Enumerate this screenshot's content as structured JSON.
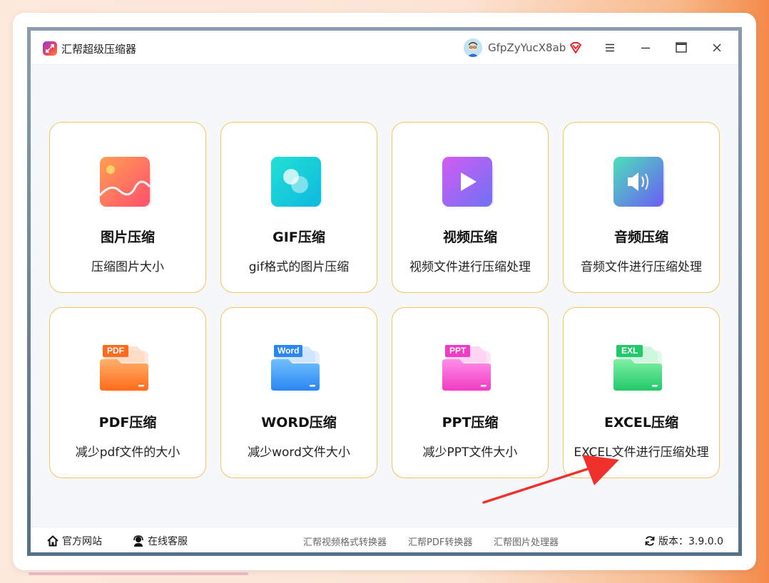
{
  "app": {
    "title": "汇帮超级压缩器",
    "username": "GfpZyYucX8ab"
  },
  "cards": [
    {
      "title": "图片压缩",
      "desc": "压缩图片大小"
    },
    {
      "title": "GIF压缩",
      "desc": "gif格式的图片压缩"
    },
    {
      "title": "视频压缩",
      "desc": "视频文件进行压缩处理"
    },
    {
      "title": "音频压缩",
      "desc": "音频文件进行压缩处理"
    },
    {
      "title": "PDF压缩",
      "desc": "减少pdf文件的大小",
      "badge": "PDF"
    },
    {
      "title": "WORD压缩",
      "desc": "减少word文件大小",
      "badge": "Word"
    },
    {
      "title": "PPT压缩",
      "desc": "减少PPT文件大小",
      "badge": "PPT"
    },
    {
      "title": "EXCEL压缩",
      "desc": "EXCEL文件进行压缩处理",
      "badge": "EXL"
    }
  ],
  "footer": {
    "website": "官方网站",
    "support": "在线客服",
    "tools": [
      "汇帮视频格式转换器",
      "汇帮PDF转换器",
      "汇帮图片处理器"
    ],
    "version": "版本：3.9.0.0"
  },
  "colors": {
    "card_border": "#f3c55a",
    "annotation_arrow": "#f0302a"
  }
}
